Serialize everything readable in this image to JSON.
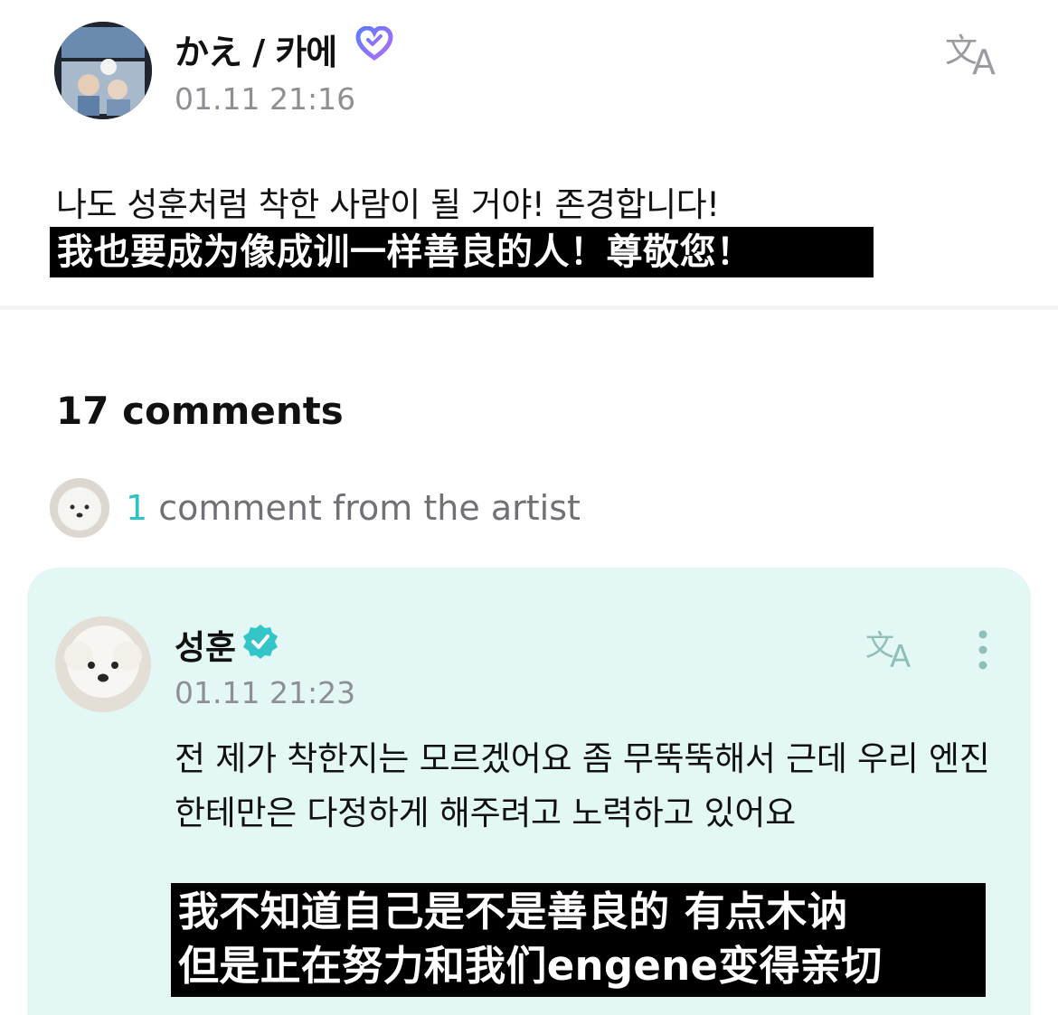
{
  "post": {
    "author": "かえ / 카에",
    "author_badge_icon": "heart-badge-icon",
    "timestamp": "01.11 21:16",
    "text": "나도 성훈처럼 착한 사람이 될 거야! 존경합니다!",
    "subtitle": "我也要成为像成训一样善良的人！尊敬您！",
    "translate_icon": "translate-icon"
  },
  "comments": {
    "count_label": "17 comments",
    "artist_summary": {
      "count": "1",
      "label": " comment from the artist"
    }
  },
  "artist_comment": {
    "name": "성훈",
    "verified_icon": "verified-check-icon",
    "timestamp": "01.11 21:23",
    "text": "전 제가 착한지는 모르겠어요 좀 무뚝뚝해서 근데 우리 엔진 한테만은 다정하게 해주려고 노력하고 있어요",
    "subtitle_line1": "我不知道自己是不是善良的 有点木讷",
    "subtitle_line2": "但是正在努力和我们engene变得亲切",
    "translate_icon": "translate-icon",
    "more_icon": "more-vertical-icon"
  },
  "colors": {
    "accent_teal": "#2ec4c4",
    "card_background": "#e3f8f5",
    "timestamp_gray": "#8d8f94",
    "heart_badge": "#8a6cff"
  }
}
